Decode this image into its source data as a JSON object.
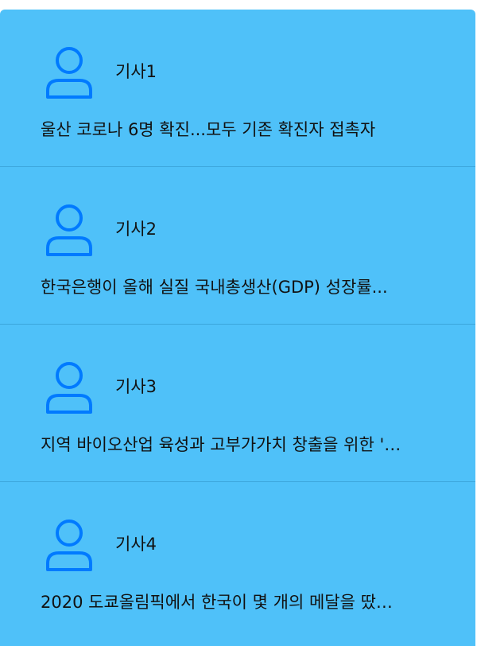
{
  "colors": {
    "list_background": "#4FC1F9",
    "icon": "#007AFF",
    "text": "#111111",
    "divider": "#3ca6dc"
  },
  "articles": [
    {
      "icon": "person-icon",
      "title": "기사1",
      "summary": "울산 코로나 6명 확진...모두 기존 확진자 접촉자"
    },
    {
      "icon": "person-icon",
      "title": "기사2",
      "summary": "한국은행이 올해 실질 국내총생산(GDP) 성장률..."
    },
    {
      "icon": "person-icon",
      "title": "기사3",
      "summary": "지역 바이오산업 육성과 고부가가치 창출을 위한 '…"
    },
    {
      "icon": "person-icon",
      "title": "기사4",
      "summary": "2020 도쿄올림픽에서 한국이 몇 개의 메달을 땄…"
    }
  ]
}
